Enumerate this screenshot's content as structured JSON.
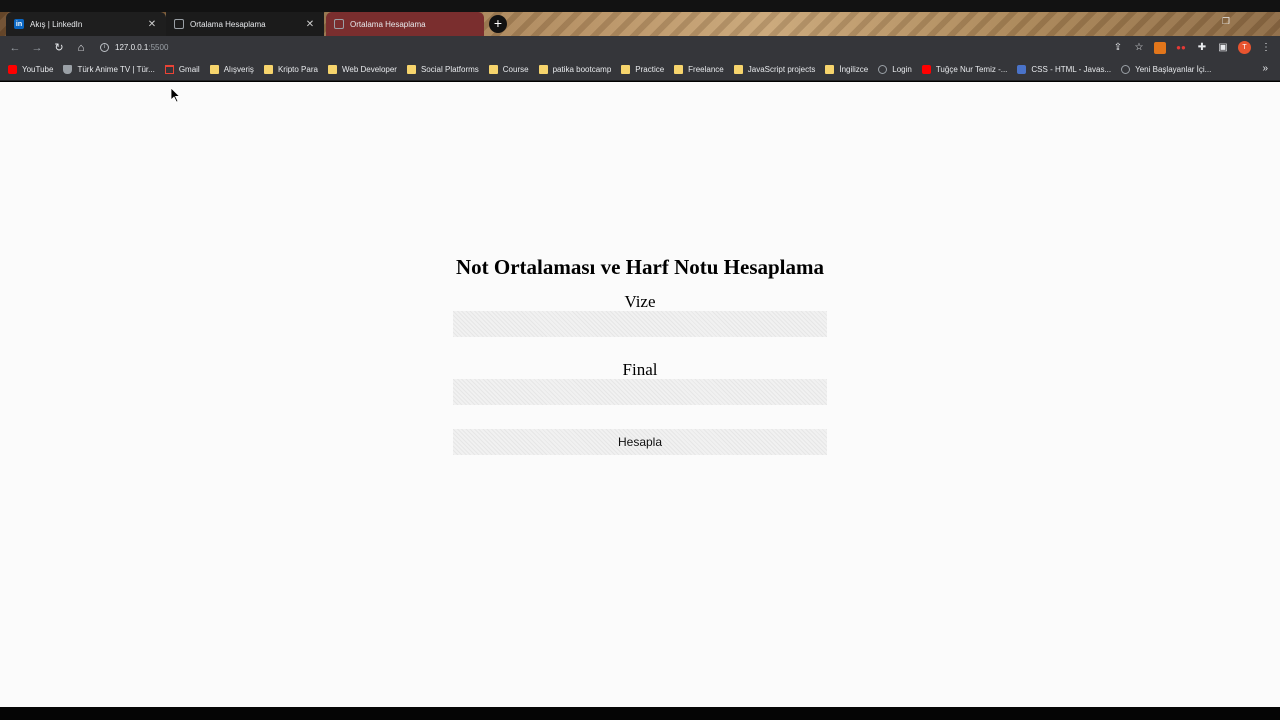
{
  "browser": {
    "tabs": [
      {
        "label": "Akış | LinkedIn",
        "icon": "linkedin-icon"
      },
      {
        "label": "Ortalama Hesaplama",
        "icon": "globe-icon"
      },
      {
        "label": "Ortalama Hesaplama",
        "icon": "globe-icon",
        "active": true
      }
    ],
    "new_tab_label": "+",
    "address": {
      "host": "127.0.0.1",
      "port": ":5500"
    },
    "profile_initial": "T",
    "bookmarks": [
      {
        "label": "YouTube",
        "icon": "youtube-icon"
      },
      {
        "label": "Türk Anime TV | Tür...",
        "icon": "shield-icon"
      },
      {
        "label": "Gmail",
        "icon": "gmail-icon"
      },
      {
        "label": "Alışveriş",
        "icon": "folder-icon"
      },
      {
        "label": "Kripto Para",
        "icon": "folder-icon"
      },
      {
        "label": "Web Developer",
        "icon": "folder-icon"
      },
      {
        "label": "Social Platforms",
        "icon": "folder-icon"
      },
      {
        "label": "Course",
        "icon": "folder-icon"
      },
      {
        "label": "patika bootcamp",
        "icon": "folder-icon"
      },
      {
        "label": "Practice",
        "icon": "folder-icon"
      },
      {
        "label": "Freelance",
        "icon": "folder-icon"
      },
      {
        "label": "JavaScript projects",
        "icon": "folder-icon"
      },
      {
        "label": "İngilizce",
        "icon": "folder-icon"
      },
      {
        "label": "Login",
        "icon": "globe-icon"
      },
      {
        "label": "Tuğçe Nur Temiz -...",
        "icon": "youtube-icon"
      },
      {
        "label": "CSS - HTML - Javas...",
        "icon": "css-icon"
      },
      {
        "label": "Yeni Başlayanlar İçi...",
        "icon": "globe-icon"
      }
    ],
    "colors": {
      "active_tab": "#7a2e2e",
      "toolbar": "#35363a",
      "page_bg": "#fbfbfb"
    }
  },
  "page": {
    "heading": "Not Ortalaması ve Harf Notu Hesaplama",
    "vize_label": "Vize",
    "vize_value": "",
    "final_label": "Final",
    "final_value": "",
    "submit_label": "Hesapla"
  }
}
